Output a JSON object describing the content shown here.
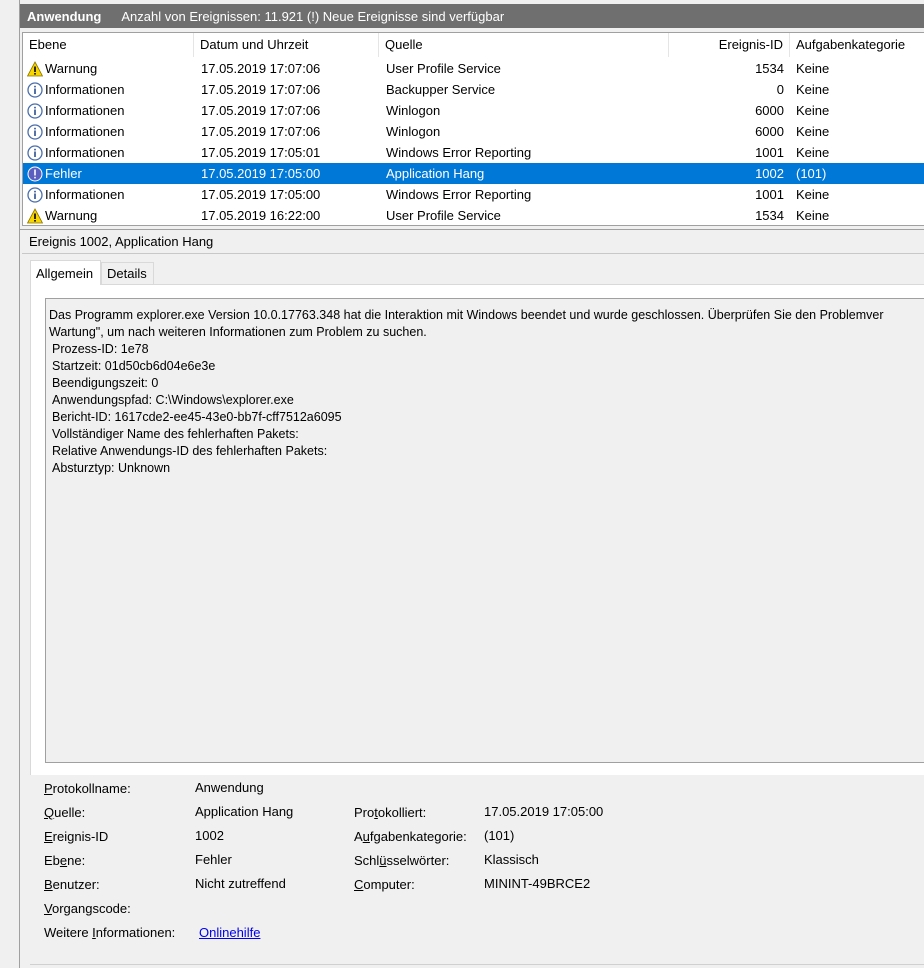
{
  "titlebar": {
    "name": "Anwendung",
    "info": "Anzahl von Ereignissen: 11.921 (!) Neue Ereignisse sind verfügbar"
  },
  "columns": {
    "ebene": "Ebene",
    "datum": "Datum und Uhrzeit",
    "quelle": "Quelle",
    "id": "Ereignis-ID",
    "kategorie": "Aufgabenkategorie"
  },
  "events": [
    {
      "icon": "warning-icon",
      "level": "Warnung",
      "date": "17.05.2019 17:07:06",
      "source": "User Profile Service",
      "id": "1534",
      "category": "Keine"
    },
    {
      "icon": "info-icon",
      "level": "Informationen",
      "date": "17.05.2019 17:07:06",
      "source": "Backupper Service",
      "id": "0",
      "category": "Keine"
    },
    {
      "icon": "info-icon",
      "level": "Informationen",
      "date": "17.05.2019 17:07:06",
      "source": "Winlogon",
      "id": "6000",
      "category": "Keine"
    },
    {
      "icon": "info-icon",
      "level": "Informationen",
      "date": "17.05.2019 17:07:06",
      "source": "Winlogon",
      "id": "6000",
      "category": "Keine"
    },
    {
      "icon": "info-icon",
      "level": "Informationen",
      "date": "17.05.2019 17:05:01",
      "source": "Windows Error Reporting",
      "id": "1001",
      "category": "Keine"
    },
    {
      "icon": "error-icon",
      "level": "Fehler",
      "date": "17.05.2019 17:05:00",
      "source": "Application Hang",
      "id": "1002",
      "category": "(101)",
      "selected": true
    },
    {
      "icon": "info-icon",
      "level": "Informationen",
      "date": "17.05.2019 17:05:00",
      "source": "Windows Error Reporting",
      "id": "1001",
      "category": "Keine"
    },
    {
      "icon": "warning-icon",
      "level": "Warnung",
      "date": "17.05.2019 16:22:00",
      "source": "User Profile Service",
      "id": "1534",
      "category": "Keine"
    }
  ],
  "detail": {
    "title": "Ereignis 1002, Application Hang",
    "tabs": [
      "Allgemein",
      "Details"
    ],
    "description": [
      "Das Programm explorer.exe Version 10.0.17763.348 hat die Interaktion mit Windows beendet und wurde geschlossen. Überprüfen Sie den Problemver",
      "Wartung\", um nach weiteren Informationen zum Problem zu suchen.",
      "Prozess-ID: 1e78",
      "Startzeit: 01d50cb6d04e6e3e",
      "Beendigungszeit: 0",
      "Anwendungspfad: C:\\Windows\\explorer.exe",
      "Bericht-ID: 1617cde2-ee45-43e0-bb7f-cff7512a6095",
      "Vollständiger Name des fehlerhaften Pakets:",
      "Relative Anwendungs-ID des fehlerhaften Pakets:",
      "Absturztyp: Unknown"
    ]
  },
  "properties": {
    "protokollname": {
      "label_key": "P",
      "label_rest": "rotokollname:",
      "value": "Anwendung"
    },
    "quelle": {
      "label_key": "Q",
      "label_rest": "uelle:",
      "value": "Application Hang"
    },
    "ereignis_id": {
      "label_key": "E",
      "label_rest": "reignis-ID",
      "value": "1002"
    },
    "ebene": {
      "label_pre": "Eb",
      "label_key": "e",
      "label_rest": "ne:",
      "value": "Fehler"
    },
    "benutzer": {
      "label_key": "B",
      "label_rest": "enutzer:",
      "value": "Nicht zutreffend"
    },
    "vorgangscode": {
      "label_key": "V",
      "label_rest": "organgscode:",
      "value": ""
    },
    "weitere": {
      "label_pre": "Weitere ",
      "label_key": "I",
      "label_rest": "nformationen:",
      "link": "Onlinehilfe"
    },
    "protokolliert": {
      "label_pre": "Pro",
      "label_key": "t",
      "label_rest": "okolliert:",
      "value": "17.05.2019 17:05:00"
    },
    "aufgabenkategorie": {
      "label_pre": "A",
      "label_key": "u",
      "label_rest": "fgabenkategorie:",
      "value": "(101)"
    },
    "schluesselwoerter": {
      "label_pre": "Schl",
      "label_key": "ü",
      "label_rest": "sselwörter:",
      "value": "Klassisch"
    },
    "computer": {
      "label_key": "C",
      "label_rest": "omputer:",
      "value": "MININT-49BRCE2"
    }
  }
}
